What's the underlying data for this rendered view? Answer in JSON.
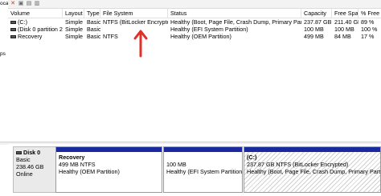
{
  "left_edge": {
    "lines": [
      "ocal",
      "",
      "",
      "",
      "",
      "",
      "ps"
    ]
  },
  "table": {
    "headers": [
      "Volume",
      "Layout",
      "Type",
      "File System",
      "Status",
      "Capacity",
      "Free Space",
      "% Free"
    ],
    "rows": [
      [
        "(C:)",
        "Simple",
        "Basic",
        "NTFS (BitLocker Encrypted)",
        "Healthy (Boot, Page File, Crash Dump, Primary Partition)",
        "237.87 GB",
        "211.40 GB",
        "89 %"
      ],
      [
        "(Disk 0 partition 2)",
        "Simple",
        "Basic",
        "",
        "Healthy (EFI System Partition)",
        "100 MB",
        "100 MB",
        "100 %"
      ],
      [
        "Recovery",
        "Simple",
        "Basic",
        "NTFS",
        "Healthy (OEM Partition)",
        "499 MB",
        "84 MB",
        "17 %"
      ]
    ]
  },
  "disk": {
    "title": "Disk 0",
    "type": "Basic",
    "size": "238.46 GB",
    "state": "Online"
  },
  "partitions": [
    {
      "name": "Recovery",
      "line1": "499 MB NTFS",
      "line2": "Healthy (OEM Partition)"
    },
    {
      "name": "",
      "line1": "100 MB",
      "line2": "Healthy (EFI System Partition)"
    },
    {
      "name": "(C:)",
      "line1": "237.87 GB NTFS (BitLocker Encrypted)",
      "line2": "Healthy (Boot, Page File, Crash Dump, Primary Partition)"
    }
  ],
  "colors": {
    "partition_bar": "#1a2a9e",
    "arrow": "#e0302a"
  }
}
